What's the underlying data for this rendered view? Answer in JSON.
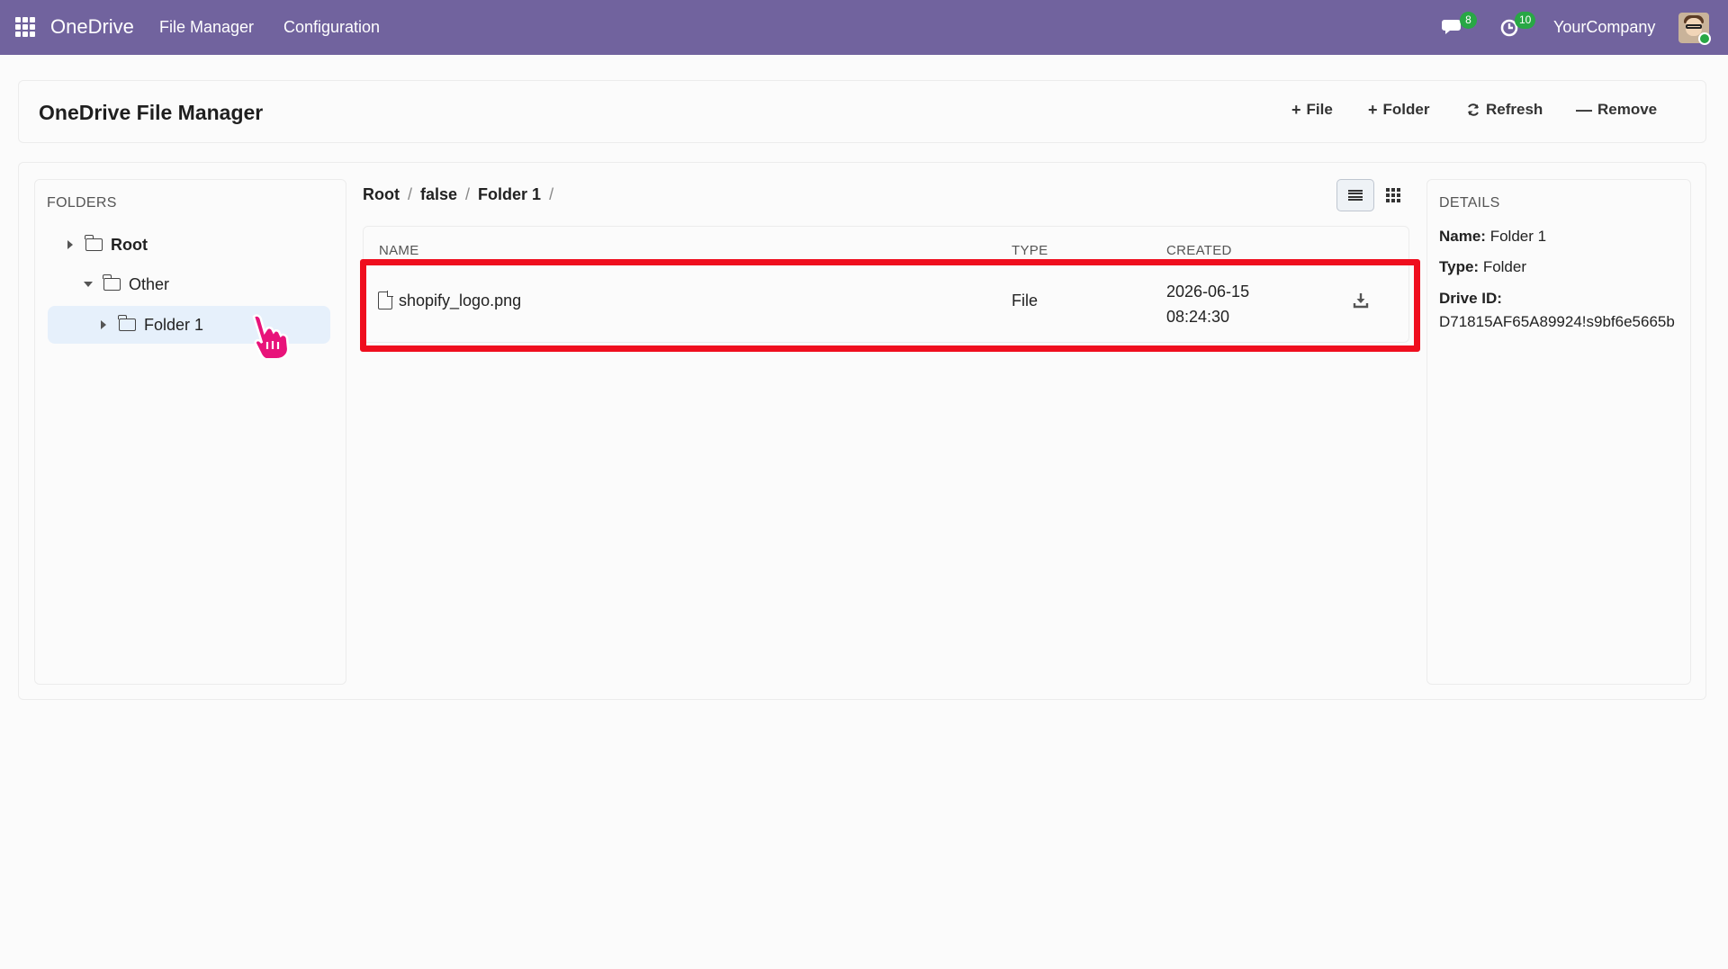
{
  "topbar": {
    "brand": "OneDrive",
    "nav": [
      "File Manager",
      "Configuration"
    ],
    "messages_count": "8",
    "activities_count": "10",
    "company": "YourCompany"
  },
  "header": {
    "title": "OneDrive File Manager",
    "actions": {
      "file": "File",
      "folder": "Folder",
      "refresh": "Refresh",
      "remove": "Remove"
    }
  },
  "folders": {
    "heading": "FOLDERS",
    "items": [
      {
        "label": "Root",
        "expanded": false,
        "bold": true
      },
      {
        "label": "Other",
        "expanded": true
      },
      {
        "label": "Folder 1",
        "expanded": false,
        "selected": true
      }
    ]
  },
  "breadcrumb": {
    "items": [
      "Root",
      "false",
      "Folder 1"
    ],
    "separator": "/"
  },
  "table": {
    "columns": [
      "NAME",
      "TYPE",
      "CREATED"
    ],
    "rows": [
      {
        "name": "shopify_logo.png",
        "type": "File",
        "created_date": "2026-06-15",
        "created_time": "08:24:30"
      }
    ]
  },
  "details": {
    "heading": "DETAILS",
    "name_label": "Name:",
    "name_value": "Folder 1",
    "type_label": "Type:",
    "type_value": "Folder",
    "drive_id_label": "Drive ID:",
    "drive_id_value": "D71815AF65A89924!s9bf6e5665b"
  },
  "colors": {
    "topbar": "#71639e",
    "badge": "#28a745",
    "highlight": "#ef0e1e",
    "selected_row": "#e6f0fb",
    "cursor": "#e8137a"
  },
  "icons": [
    "apps-grid-icon",
    "chat-icon",
    "activity-clock-icon",
    "plus-icon",
    "minus-icon",
    "refresh-icon",
    "folder-icon",
    "file-icon",
    "download-icon",
    "list-view-icon",
    "grid-view-icon",
    "caret-right-icon",
    "caret-down-icon",
    "hand-cursor-icon"
  ]
}
